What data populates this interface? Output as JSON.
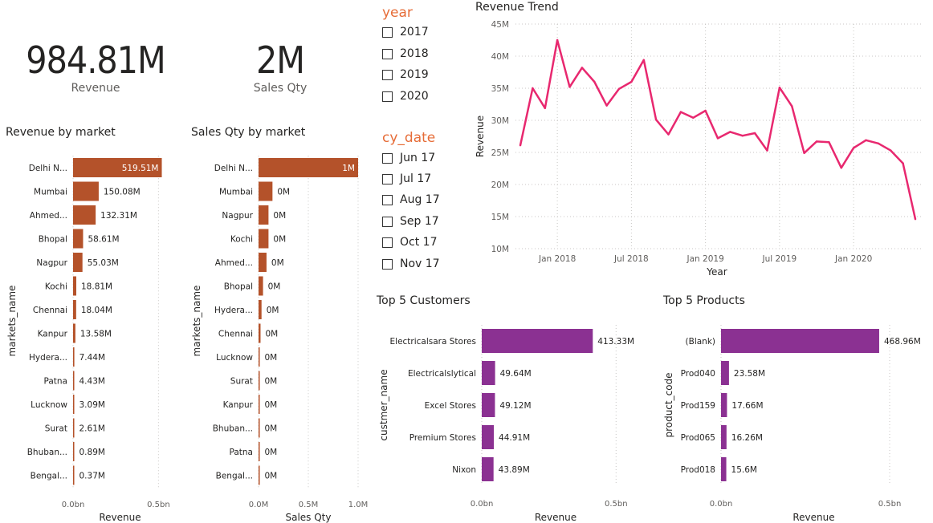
{
  "kpis": [
    {
      "value": "984.81M",
      "label": "Revenue"
    },
    {
      "value": "2M",
      "label": "Sales Qty"
    }
  ],
  "slicers": {
    "year": {
      "title": "year",
      "items": [
        "2017",
        "2018",
        "2019",
        "2020"
      ]
    },
    "cy_date": {
      "title": "cy_date",
      "items": [
        "Jun 17",
        "Jul 17",
        "Aug 17",
        "Sep 17",
        "Oct 17",
        "Nov 17"
      ]
    }
  },
  "colors": {
    "market_bars": "#b4522a",
    "top5_bars": "#8b3192",
    "line": "#e8286f",
    "slicer_title": "#e66c37"
  },
  "chart_data": [
    {
      "type": "bar",
      "orientation": "horizontal",
      "title": "Revenue by market",
      "xlabel": "Revenue",
      "ylabel": "markets_name",
      "categories": [
        "Delhi N...",
        "Mumbai",
        "Ahmed...",
        "Bhopal",
        "Nagpur",
        "Kochi",
        "Chennai",
        "Kanpur",
        "Hydera...",
        "Patna",
        "Lucknow",
        "Surat",
        "Bhuban...",
        "Bengal..."
      ],
      "values": [
        519.51,
        150.08,
        132.31,
        58.61,
        55.03,
        18.81,
        18.04,
        13.58,
        7.44,
        4.43,
        3.09,
        2.61,
        0.89,
        0.37
      ],
      "value_unit": "M",
      "data_labels": [
        "519.51M",
        "150.08M",
        "132.31M",
        "58.61M",
        "55.03M",
        "18.81M",
        "18.04M",
        "13.58M",
        "7.44M",
        "4.43M",
        "3.09M",
        "2.61M",
        "0.89M",
        "0.37M"
      ],
      "xlim": [
        0,
        0.55
      ],
      "x_unit": "bn",
      "xticks": [
        "0.0bn",
        "0.5bn"
      ],
      "xtick_values": [
        0,
        0.5
      ],
      "grid": true
    },
    {
      "type": "bar",
      "orientation": "horizontal",
      "title": "Sales Qty by market",
      "xlabel": "Sales Qty",
      "ylabel": "markets_name",
      "categories": [
        "Delhi N...",
        "Mumbai",
        "Nagpur",
        "Kochi",
        "Ahmed...",
        "Bhopal",
        "Hydera...",
        "Chennai",
        "Lucknow",
        "Surat",
        "Kanpur",
        "Bhuban...",
        "Patna",
        "Bengal..."
      ],
      "values": [
        1.0,
        0.14,
        0.1,
        0.1,
        0.08,
        0.045,
        0.03,
        0.02,
        0.01,
        0.005,
        0.005,
        0.004,
        0.002,
        0.001
      ],
      "value_unit": "M",
      "data_labels": [
        "1M",
        "0M",
        "0M",
        "0M",
        "0M",
        "0M",
        "0M",
        "0M",
        "0M",
        "0M",
        "0M",
        "0M",
        "0M",
        "0M"
      ],
      "xlim": [
        0,
        1.0
      ],
      "xticks": [
        "0.0M",
        "0.5M",
        "1.0M"
      ],
      "xtick_values": [
        0,
        0.5,
        1.0
      ],
      "grid": true
    },
    {
      "type": "line",
      "title": "Revenue Trend",
      "xlabel": "Year",
      "ylabel": "Revenue",
      "x": [
        "2017-10",
        "2017-11",
        "2017-12",
        "2018-01",
        "2018-02",
        "2018-03",
        "2018-04",
        "2018-05",
        "2018-06",
        "2018-07",
        "2018-08",
        "2018-09",
        "2018-10",
        "2018-11",
        "2018-12",
        "2019-01",
        "2019-02",
        "2019-03",
        "2019-04",
        "2019-05",
        "2019-06",
        "2019-07",
        "2019-08",
        "2019-09",
        "2019-10",
        "2019-11",
        "2019-12",
        "2020-01",
        "2020-02",
        "2020-03",
        "2020-04",
        "2020-05",
        "2020-06"
      ],
      "values": [
        26.1,
        35.0,
        31.9,
        42.5,
        35.2,
        38.2,
        36.0,
        32.3,
        34.9,
        36.0,
        39.4,
        30.1,
        27.8,
        31.3,
        30.4,
        31.5,
        27.2,
        28.2,
        27.6,
        28.0,
        25.3,
        35.1,
        32.2,
        24.9,
        26.7,
        26.6,
        22.6,
        25.7,
        26.9,
        26.4,
        25.3,
        23.3,
        14.6
      ],
      "value_unit": "M",
      "ylim": [
        10,
        45
      ],
      "yticks": [
        "10M",
        "15M",
        "20M",
        "25M",
        "30M",
        "35M",
        "40M",
        "45M"
      ],
      "ytick_values": [
        10,
        15,
        20,
        25,
        30,
        35,
        40,
        45
      ],
      "xticks": [
        "Jan 2018",
        "Jul 2018",
        "Jan 2019",
        "Jul 2019",
        "Jan 2020"
      ],
      "xtick_positions": [
        "2018-01",
        "2018-07",
        "2019-01",
        "2019-07",
        "2020-01"
      ],
      "grid": true
    },
    {
      "type": "bar",
      "orientation": "horizontal",
      "title": "Top 5 Customers",
      "xlabel": "Revenue",
      "ylabel": "custmer_name",
      "categories": [
        "Electricalsara Stores",
        "Electricalslytical",
        "Excel Stores",
        "Premium Stores",
        "Nixon"
      ],
      "values": [
        413.33,
        49.64,
        49.12,
        44.91,
        43.89
      ],
      "value_unit": "M",
      "data_labels": [
        "413.33M",
        "49.64M",
        "49.12M",
        "44.91M",
        "43.89M"
      ],
      "xlim": [
        0,
        0.55
      ],
      "x_unit": "bn",
      "xticks": [
        "0.0bn",
        "0.5bn"
      ],
      "xtick_values": [
        0,
        0.5
      ],
      "grid": true
    },
    {
      "type": "bar",
      "orientation": "horizontal",
      "title": "Top 5 Products",
      "xlabel": "Revenue",
      "ylabel": "product_code",
      "categories": [
        "(Blank)",
        "Prod040",
        "Prod159",
        "Prod065",
        "Prod018"
      ],
      "values": [
        468.96,
        23.58,
        17.66,
        16.26,
        15.6
      ],
      "value_unit": "M",
      "data_labels": [
        "468.96M",
        "23.58M",
        "17.66M",
        "16.26M",
        "15.6M"
      ],
      "xlim": [
        0,
        0.55
      ],
      "x_unit": "bn",
      "xticks": [
        "0.0bn",
        "0.5bn"
      ],
      "xtick_values": [
        0,
        0.5
      ],
      "grid": true
    }
  ]
}
